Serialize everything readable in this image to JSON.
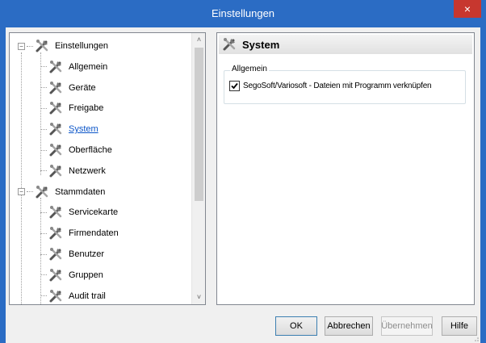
{
  "window": {
    "title": "Einstellungen",
    "close_glyph": "×"
  },
  "tree": {
    "groups": [
      {
        "label": "Einstellungen",
        "expander": "−",
        "children": [
          "Allgemein",
          "Geräte",
          "Freigabe",
          "System",
          "Oberfläche",
          "Netzwerk"
        ]
      },
      {
        "label": "Stammdaten",
        "expander": "−",
        "children": [
          "Servicekarte",
          "Firmendaten",
          "Benutzer",
          "Gruppen",
          "Audit trail"
        ]
      }
    ],
    "selected": "System",
    "icon": "tools-icon"
  },
  "scrollbar": {
    "up_glyph": "˄",
    "down_glyph": "˅"
  },
  "panel": {
    "title": "System",
    "group_label": "Allgemein",
    "checkbox_label": "SegoSoft/Variosoft - Dateien mit Programm verknüpfen",
    "checkbox_checked": true
  },
  "buttons": {
    "ok": "OK",
    "cancel": "Abbrechen",
    "apply": "Übernehmen",
    "help": "Hilfe"
  },
  "colors": {
    "titlebar": "#2b6cc4",
    "close": "#c7372f",
    "selected_text": "#0b55c8"
  }
}
